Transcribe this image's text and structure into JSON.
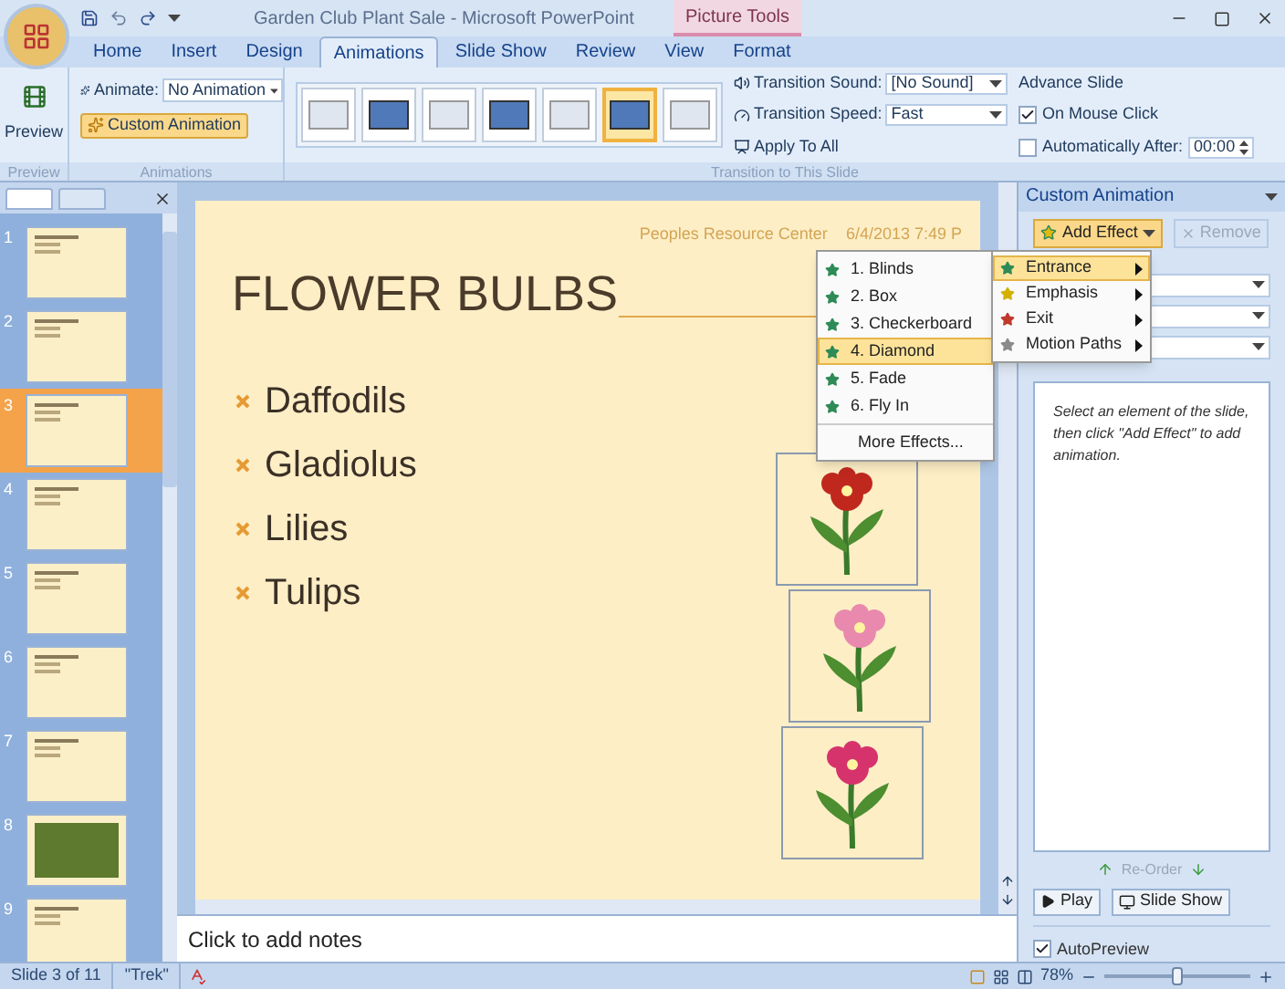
{
  "window": {
    "title": "Garden Club Plant Sale - Microsoft PowerPoint",
    "context_tab": "Picture Tools"
  },
  "ribbon_tabs": [
    {
      "label": "Home",
      "selected": false
    },
    {
      "label": "Insert",
      "selected": false
    },
    {
      "label": "Design",
      "selected": false
    },
    {
      "label": "Animations",
      "selected": true
    },
    {
      "label": "Slide Show",
      "selected": false
    },
    {
      "label": "Review",
      "selected": false
    },
    {
      "label": "View",
      "selected": false
    },
    {
      "label": "Format",
      "selected": false
    }
  ],
  "ribbon": {
    "preview": {
      "button": "Preview",
      "group": "Preview"
    },
    "animations": {
      "animate_label": "Animate:",
      "animate_value": "No Animation",
      "custom_animation": "Custom Animation",
      "group": "Animations"
    },
    "transitions": {
      "thumbnails": [
        {
          "selected": false
        },
        {
          "selected": false
        },
        {
          "selected": false
        },
        {
          "selected": false
        },
        {
          "selected": false
        },
        {
          "selected": true
        },
        {
          "selected": false
        }
      ],
      "sound_label": "Transition Sound:",
      "sound_value": "[No Sound]",
      "speed_label": "Transition Speed:",
      "speed_value": "Fast",
      "apply_all": "Apply To All",
      "advance_title": "Advance Slide",
      "on_click": {
        "label": "On Mouse Click",
        "checked": true
      },
      "auto_after": {
        "label": "Automatically After:",
        "checked": false,
        "value": "00:00"
      },
      "group": "Transition to This Slide"
    }
  },
  "slides_panel": {
    "slides": [
      {
        "number": "1",
        "kind": "text",
        "selected": false
      },
      {
        "number": "2",
        "kind": "text",
        "selected": false
      },
      {
        "number": "3",
        "kind": "text",
        "selected": true
      },
      {
        "number": "4",
        "kind": "text",
        "selected": false
      },
      {
        "number": "5",
        "kind": "text",
        "selected": false
      },
      {
        "number": "6",
        "kind": "text",
        "selected": false
      },
      {
        "number": "7",
        "kind": "text",
        "selected": false
      },
      {
        "number": "8",
        "kind": "photo",
        "selected": false
      },
      {
        "number": "9",
        "kind": "text",
        "selected": false
      }
    ]
  },
  "slide": {
    "footer_org": "Peoples Resource Center",
    "footer_date": "6/4/2013 7:49 P",
    "title": "FLOWER BULBS",
    "bullets": [
      "Daffodils",
      "Gladiolus",
      "Lilies",
      "Tulips"
    ]
  },
  "notes": {
    "placeholder": "Click to add notes"
  },
  "entrance_submenu": {
    "items": [
      {
        "label": "1. Blinds",
        "selected": false
      },
      {
        "label": "2. Box",
        "selected": false
      },
      {
        "label": "3. Checkerboard",
        "selected": false
      },
      {
        "label": "4. Diamond",
        "selected": true
      },
      {
        "label": "5. Fade",
        "selected": false
      },
      {
        "label": "6. Fly In",
        "selected": false
      }
    ],
    "more": "More Effects..."
  },
  "effect_menu": {
    "items": [
      {
        "label": "Entrance",
        "selected": true,
        "color": "#2e8b57"
      },
      {
        "label": "Emphasis",
        "selected": false,
        "color": "#d4b000"
      },
      {
        "label": "Exit",
        "selected": false,
        "color": "#c0392b"
      },
      {
        "label": "Motion Paths",
        "selected": false,
        "color": "#8a8a8a"
      }
    ]
  },
  "custom_animation": {
    "title": "Custom Animation",
    "add_effect": "Add Effect",
    "remove": "Remove",
    "hint": "Select an element of the slide, then click \"Add Effect\" to add animation.",
    "reorder": "Re-Order",
    "play": "Play",
    "slide_show": "Slide Show",
    "autopreview": {
      "label": "AutoPreview",
      "checked": true
    }
  },
  "status_bar": {
    "slide": "Slide 3 of 11",
    "theme": "\"Trek\"",
    "zoom": "78%",
    "zoom_slider": {
      "level": 0.5
    }
  }
}
